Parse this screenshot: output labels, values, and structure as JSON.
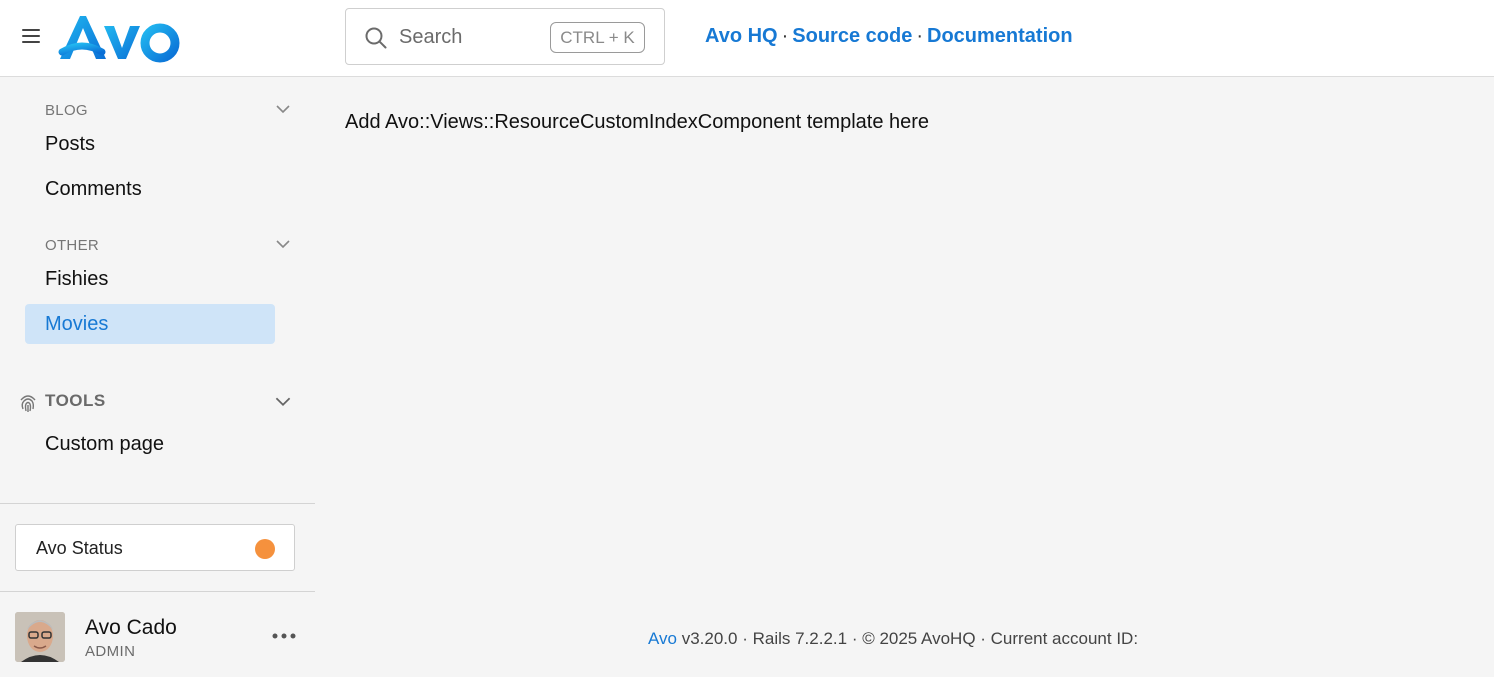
{
  "header": {
    "logo_text": "Avo",
    "search": {
      "placeholder": "Search",
      "shortcut": "CTRL + K"
    },
    "links": [
      {
        "label": "Avo HQ"
      },
      {
        "label": "Source code"
      },
      {
        "label": "Documentation"
      }
    ],
    "link_separator": "·"
  },
  "sidebar": {
    "sections": [
      {
        "heading": "BLOG",
        "items": [
          "Posts",
          "Comments"
        ]
      },
      {
        "heading": "OTHER",
        "items": [
          "Fishies",
          "Movies"
        ],
        "active": "Movies"
      },
      {
        "heading": "TOOLS",
        "icon": "fingerprint-icon",
        "items": [
          "Custom page"
        ]
      }
    ],
    "status": {
      "label": "Avo Status",
      "dot_color": "#f5913d"
    },
    "user": {
      "name": "Avo Cado",
      "role": "ADMIN"
    }
  },
  "main": {
    "placeholder_text": "Add Avo::Views::ResourceCustomIndexComponent template here"
  },
  "footer": {
    "brand": "Avo",
    "text": " v3.20.0 · Rails 7.2.2.1 · © 2025 AvoHQ · Current account ID:"
  },
  "colors": {
    "accent": "#1779d4",
    "active_bg": "#cfe4f8",
    "background": "#f5f5f5"
  }
}
